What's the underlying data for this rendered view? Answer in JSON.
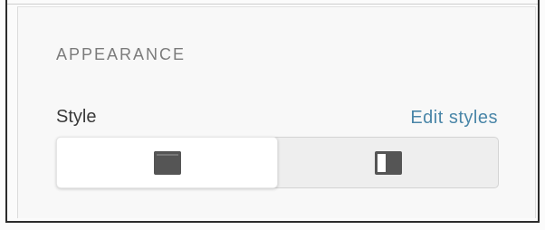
{
  "appearance": {
    "section_title": "APPEARANCE",
    "style_label": "Style",
    "edit_styles_link": "Edit styles",
    "style_options": [
      {
        "icon": "layout-full-icon",
        "selected": true
      },
      {
        "icon": "layout-sidebar-icon",
        "selected": false
      }
    ]
  },
  "colors": {
    "accent_link": "#4a86a8",
    "icon": "#555555"
  }
}
